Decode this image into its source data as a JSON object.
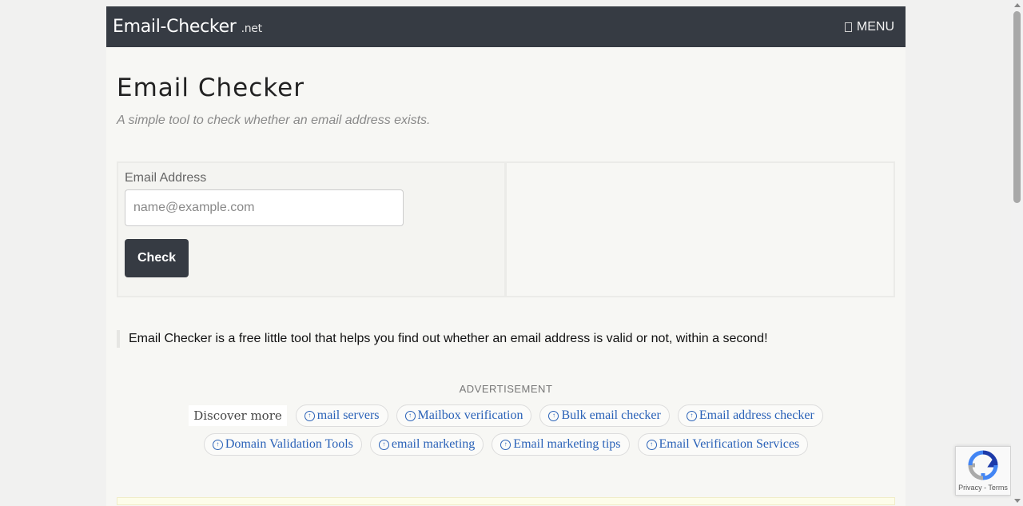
{
  "header": {
    "brand_name": "Email-Checker",
    "brand_tld": ".net",
    "menu_label": "MENU"
  },
  "main": {
    "title": "Email Checker",
    "subtitle": "A simple tool to check whether an email address exists.",
    "form": {
      "email_label": "Email Address",
      "email_placeholder": "name@example.com",
      "email_value": "",
      "check_button_label": "Check"
    },
    "blurb": "Email Checker is a free little tool that helps you find out whether an email address is valid or not, within a second!",
    "ad_label": "ADVERTISEMENT",
    "discover": {
      "label": "Discover more",
      "row1": [
        "mail servers",
        "Mailbox verification",
        "Bulk email checker",
        "Email address checker"
      ],
      "row2": [
        "Domain Validation Tools",
        "email marketing",
        "Email marketing tips",
        "Email Verification Services"
      ]
    }
  },
  "recaptcha": {
    "privacy_label": "Privacy",
    "separator": " - ",
    "terms_label": "Terms"
  },
  "colors": {
    "navbar": "#363b43",
    "link": "#2a62b8",
    "page_bg": "#f7f7f4"
  }
}
